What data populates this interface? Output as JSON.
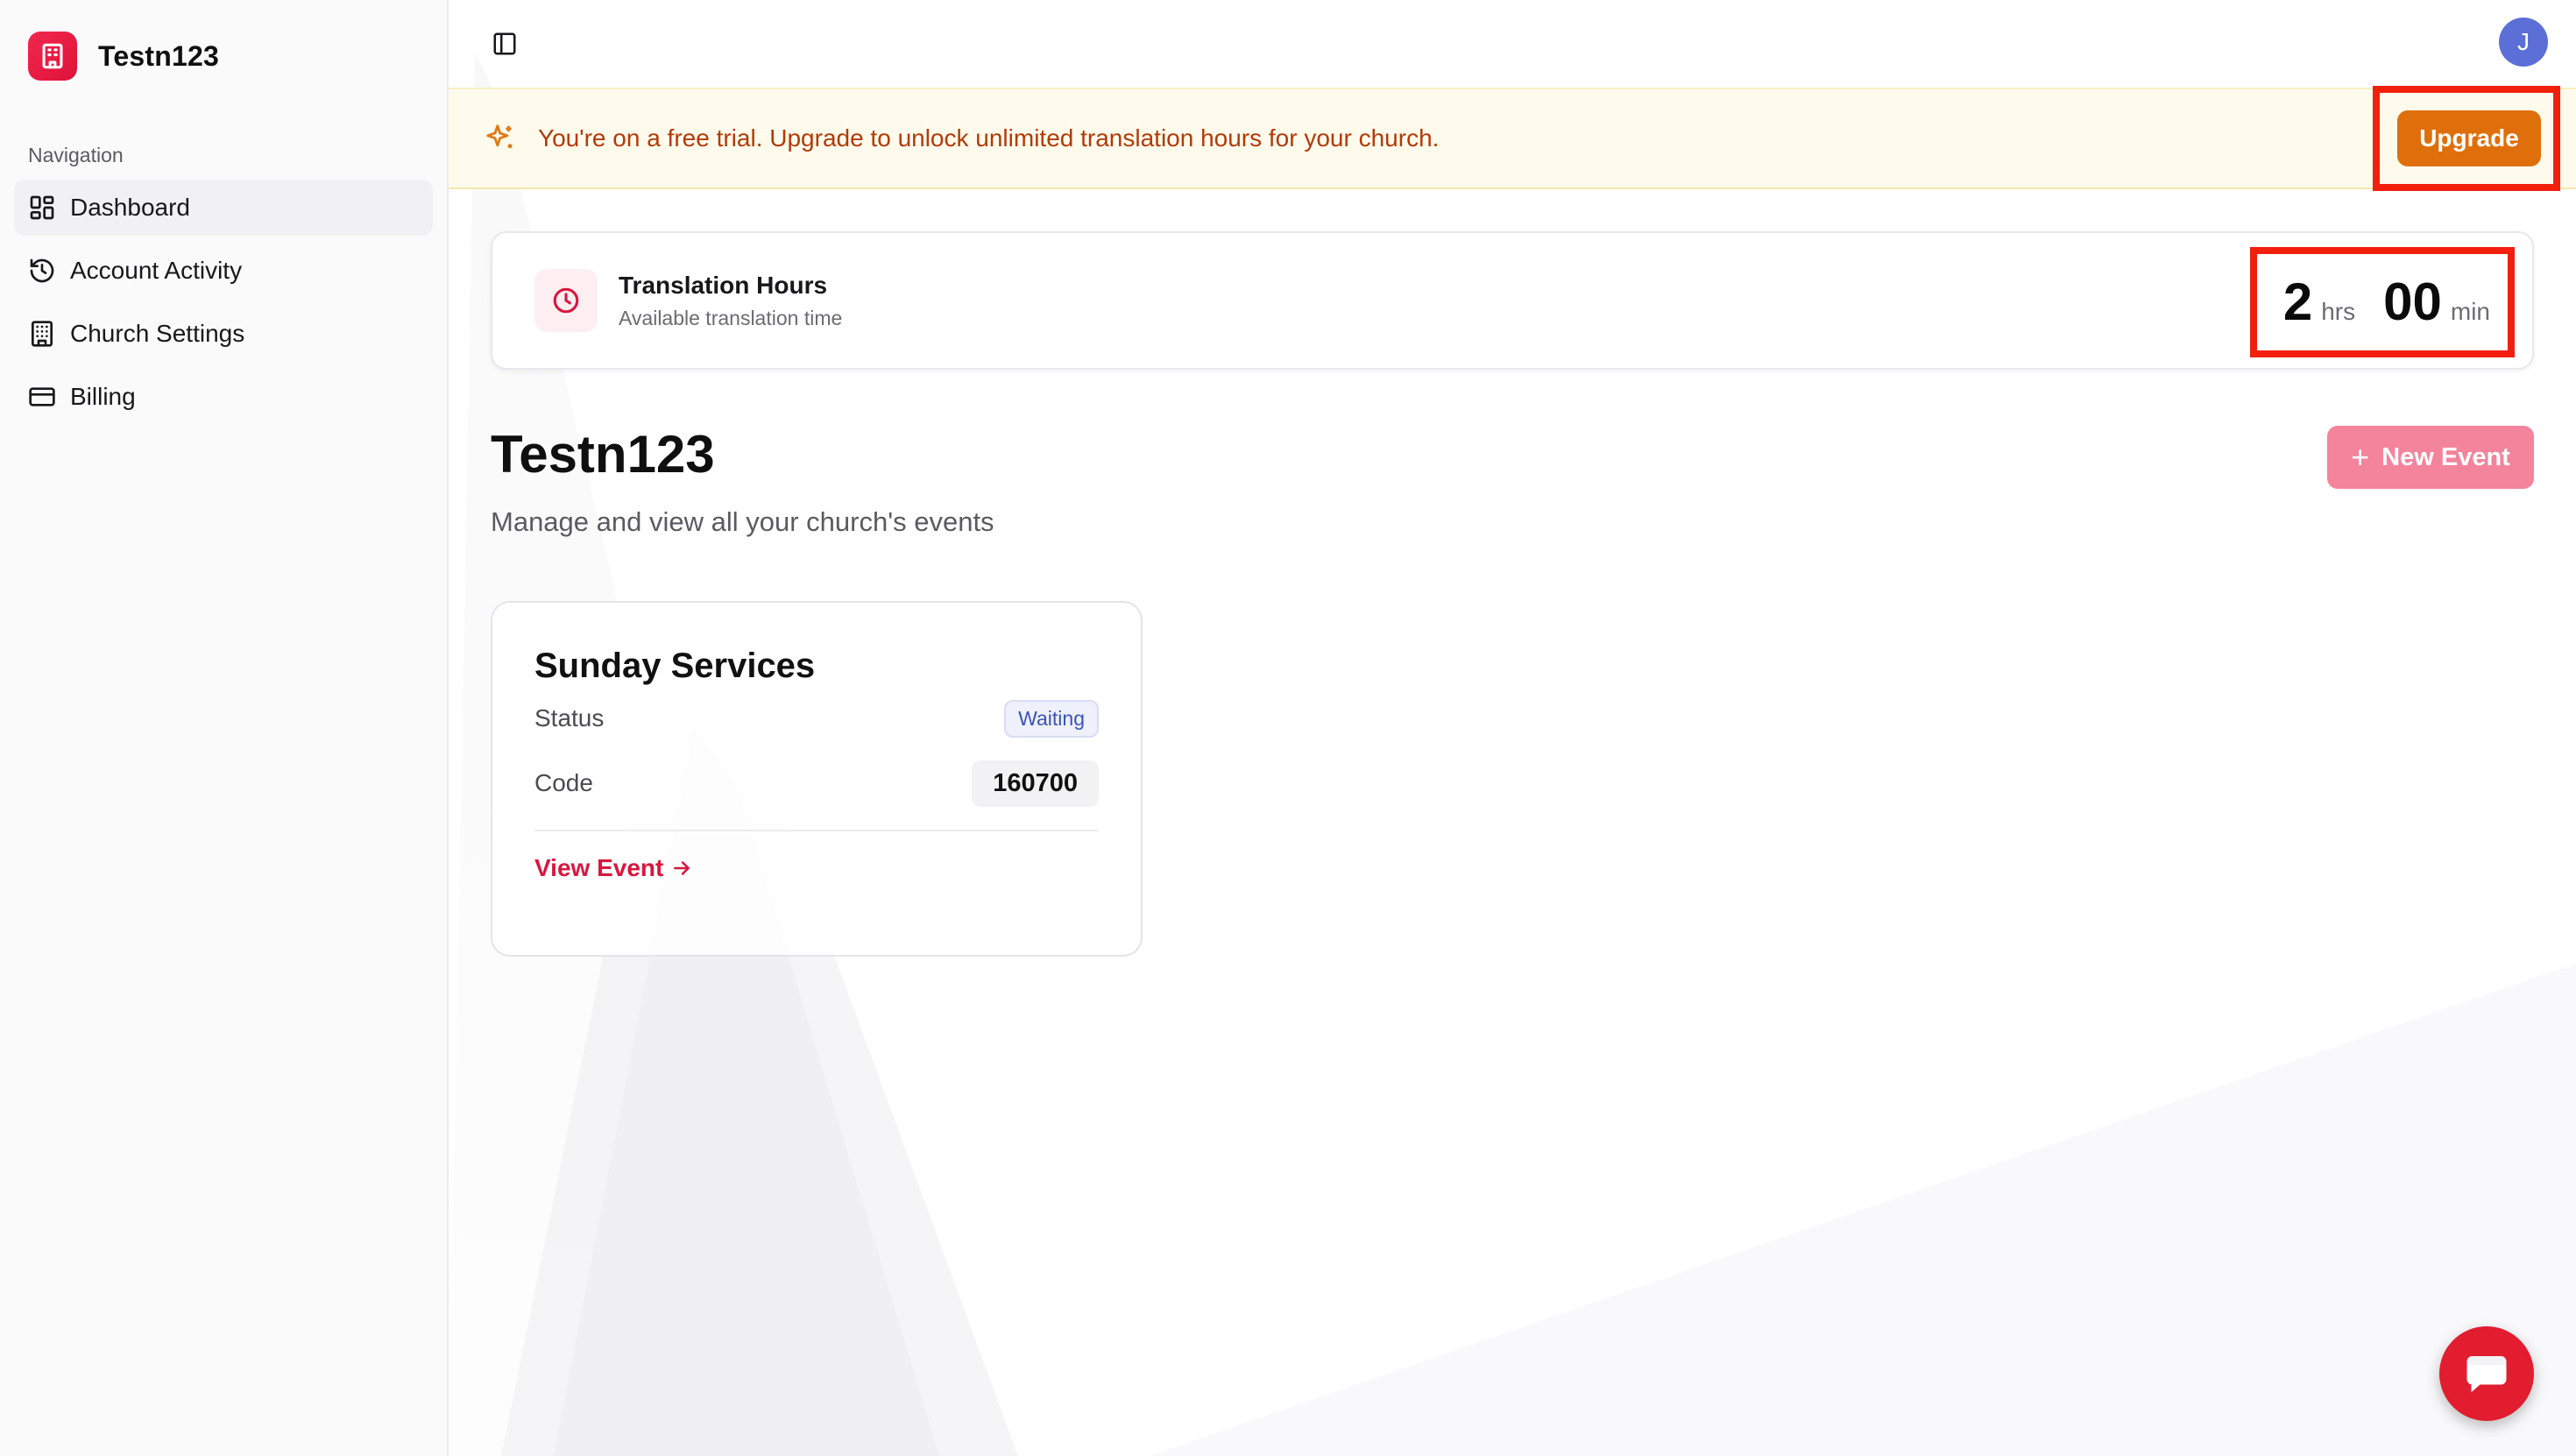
{
  "brand": {
    "name": "Testn123"
  },
  "sidebar": {
    "section_label": "Navigation",
    "items": [
      {
        "label": "Dashboard",
        "icon": "dashboard-icon",
        "active": true
      },
      {
        "label": "Account Activity",
        "icon": "history-icon",
        "active": false
      },
      {
        "label": "Church Settings",
        "icon": "building-icon",
        "active": false
      },
      {
        "label": "Billing",
        "icon": "credit-card-icon",
        "active": false
      }
    ]
  },
  "header": {
    "avatar_initial": "J"
  },
  "trial_banner": {
    "message": "You're on a free trial. Upgrade to unlock unlimited translation hours for your church.",
    "upgrade_label": "Upgrade"
  },
  "hours_card": {
    "title": "Translation Hours",
    "subtitle": "Available translation time",
    "hours": "2",
    "hours_unit": "hrs",
    "minutes": "00",
    "minutes_unit": "min"
  },
  "page": {
    "title": "Testn123",
    "subtitle": "Manage and view all your church's events",
    "new_event_label": "New Event"
  },
  "events": [
    {
      "title": "Sunday Services",
      "status_label": "Status",
      "status_value": "Waiting",
      "code_label": "Code",
      "code_value": "160700",
      "link_label": "View Event"
    }
  ],
  "colors": {
    "brand": "#e0113a",
    "upgrade": "#df6f0b",
    "banner_bg": "#fefbec",
    "new_event": "#f3849c",
    "link": "#d8173f",
    "highlight": "#f21f0c"
  }
}
